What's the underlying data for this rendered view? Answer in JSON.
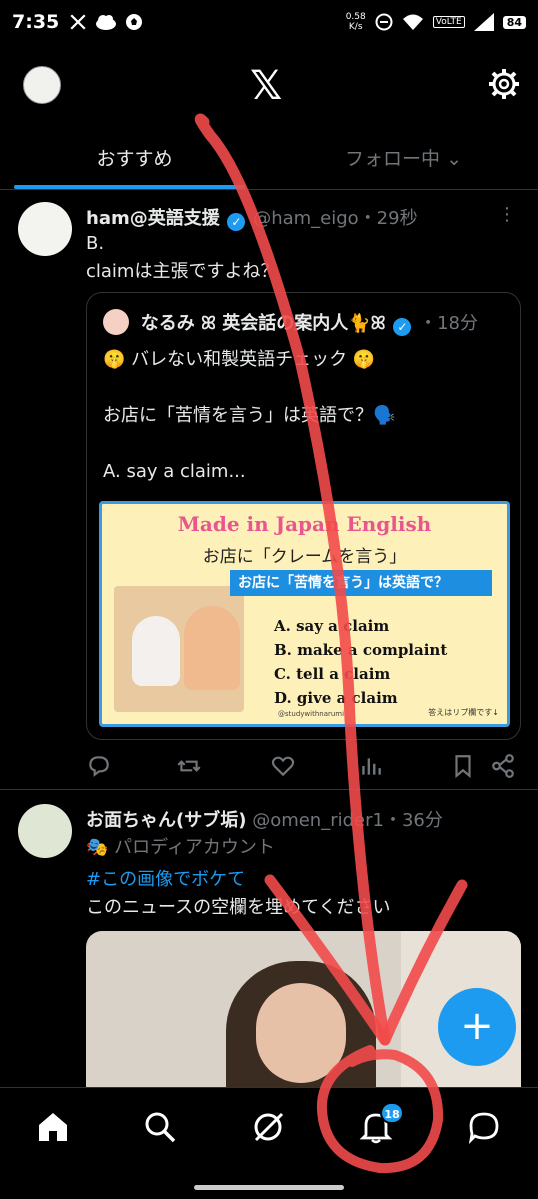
{
  "status_bar": {
    "time": "7:35",
    "net_speed": "0.58",
    "net_unit": "K/s",
    "volte": "VoLTE",
    "signal": "4G",
    "battery": "84"
  },
  "tabs": [
    {
      "label": "おすすめ"
    },
    {
      "label": "フォロー中"
    }
  ],
  "tweet1": {
    "name": "ham@英語支援",
    "handle": "@ham_eigo",
    "time": "・29秒",
    "line1": "B.",
    "line2": "claimは主張ですよね？",
    "quote": {
      "name": "なるみ ꕤ 英会話の案内人🐈ꕤ",
      "time": "・18分",
      "line1": "🤫 バレない和製英語チェック 🤫",
      "line2": "お店に「苦情を言う」は英語で？🗣️",
      "line3": "A. say a claim...",
      "image": {
        "title": "Made in Japan English",
        "subtitle": "お店に「クレームを言う」",
        "banner": "お店に「苦情を言う」は英語で？",
        "options": [
          "A. say a claim",
          "B. make a complaint",
          "C. tell a claim",
          "D. give a claim"
        ],
        "note": "答えはリプ欄です↓",
        "credit": "@studywithnarumi"
      }
    }
  },
  "tweet2": {
    "name": "お面ちゃん(サブ垢)",
    "handle": "@omen_rider1",
    "time": "・36分",
    "parody": "パロディアカウント",
    "hashtag": "#この画像でボケて",
    "text": "このニュースの空欄を埋めてください"
  },
  "nav": {
    "notification_count": "18"
  },
  "colors": {
    "accent": "#1d9bf0",
    "background": "#000000",
    "annotation": "#f24a4a"
  }
}
